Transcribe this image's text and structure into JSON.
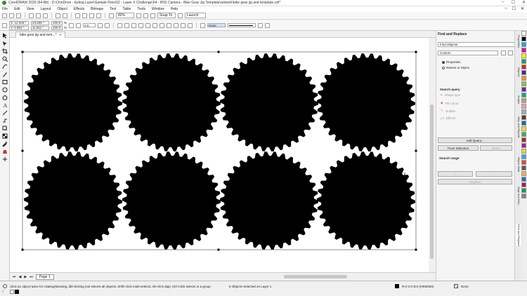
{
  "window": {
    "title": "CorelDRAW 2020 (64-Bit) - D:\\OneDrive - Epilog Laser\\Sample Files\\02 - Laser X Challenge\\04 - IRIS Camera - Bike Gear Jig Template\\artwork\\bike gear jig and template.cdr*",
    "min": "–",
    "max": "☐",
    "close": "✕"
  },
  "menu": [
    "File",
    "Edit",
    "View",
    "Layout",
    "Object",
    "Effects",
    "Bitmaps",
    "Text",
    "Table",
    "Tools",
    "Window",
    "Help"
  ],
  "toolbar": {
    "zoom": "82%",
    "snap": "Snap To",
    "launch": "Launch"
  },
  "propbar": {
    "x": "X: 12.045 \"",
    "y": "Y: 5.953 \"",
    "w": "23.638 \"",
    "h": "11.811 \"",
    "sx": "100.0",
    "sy": "100.0",
    "pct": "%",
    "angle": "0.0",
    "outline_width": "None"
  },
  "doc": {
    "tab": "bike gear jig and tem...*",
    "page": "Page 1"
  },
  "docker": {
    "title": "Find and Replace",
    "mode": "Find Objects",
    "preset": "Custom",
    "radio1": "Properties",
    "radio2": "Names or Styles",
    "query_label": "Search query",
    "query_items": [
      "Shape type",
      "Fill colour",
      "Outline",
      "Effects"
    ],
    "add_query": "Add Query...",
    "from_selection": "From Selection",
    "reset": "Reset",
    "range_label": "Search range",
    "find_prev": "‹",
    "find_next": "›",
    "replace": "Replace"
  },
  "side_tabs": [
    "Properties",
    "Objects",
    "Scripts",
    "Step and Repeat",
    "Object Data",
    "Align and Dist...",
    "Find and Replace"
  ],
  "palette": [
    "#ffffff",
    "#000000",
    "#00aeef",
    "#ec008c",
    "#fff200",
    "#00a651",
    "#ed1c24",
    "#2e3192",
    "#f7941d",
    "#8dc63f",
    "#662d91",
    "#00a99d",
    "#c49a6c",
    "#f49ac1",
    "#a7a9ac",
    "#603913",
    "#0072bc",
    "#ffde17",
    "#39b54a",
    "#be1e2d",
    "#92278f",
    "#d7df23",
    "#27aae1",
    "#ef4136",
    "#58595b",
    "#fbb040",
    "#1c75bc",
    "#9e1f63",
    "#00a14b",
    "#808285"
  ],
  "status": {
    "hint": "Click an object twice for rotating/skewing; dbl-clicking tool selects all objects; Shift+click multi-selects; Alt+click digs; Ctrl+click selects in a group",
    "selection": "8 Objects Selected on Layer 1",
    "fill": "R:0 G:0 B:0 (#000000)",
    "outline": "None"
  },
  "colors": {
    "gear": "#000000",
    "accent": "#3b8a3b"
  },
  "icons": [
    "pick-tool-icon",
    "shape-tool-icon",
    "crop-tool-icon",
    "zoom-tool-icon",
    "freehand-tool-icon",
    "artistic-media-icon",
    "rectangle-tool-icon",
    "ellipse-tool-icon",
    "polygon-tool-icon",
    "text-tool-icon",
    "parallel-dimension-icon",
    "connector-icon",
    "drop-shadow-icon",
    "transparency-icon",
    "eyedropper-icon",
    "interactive-fill-icon",
    "smart-fill-icon"
  ]
}
